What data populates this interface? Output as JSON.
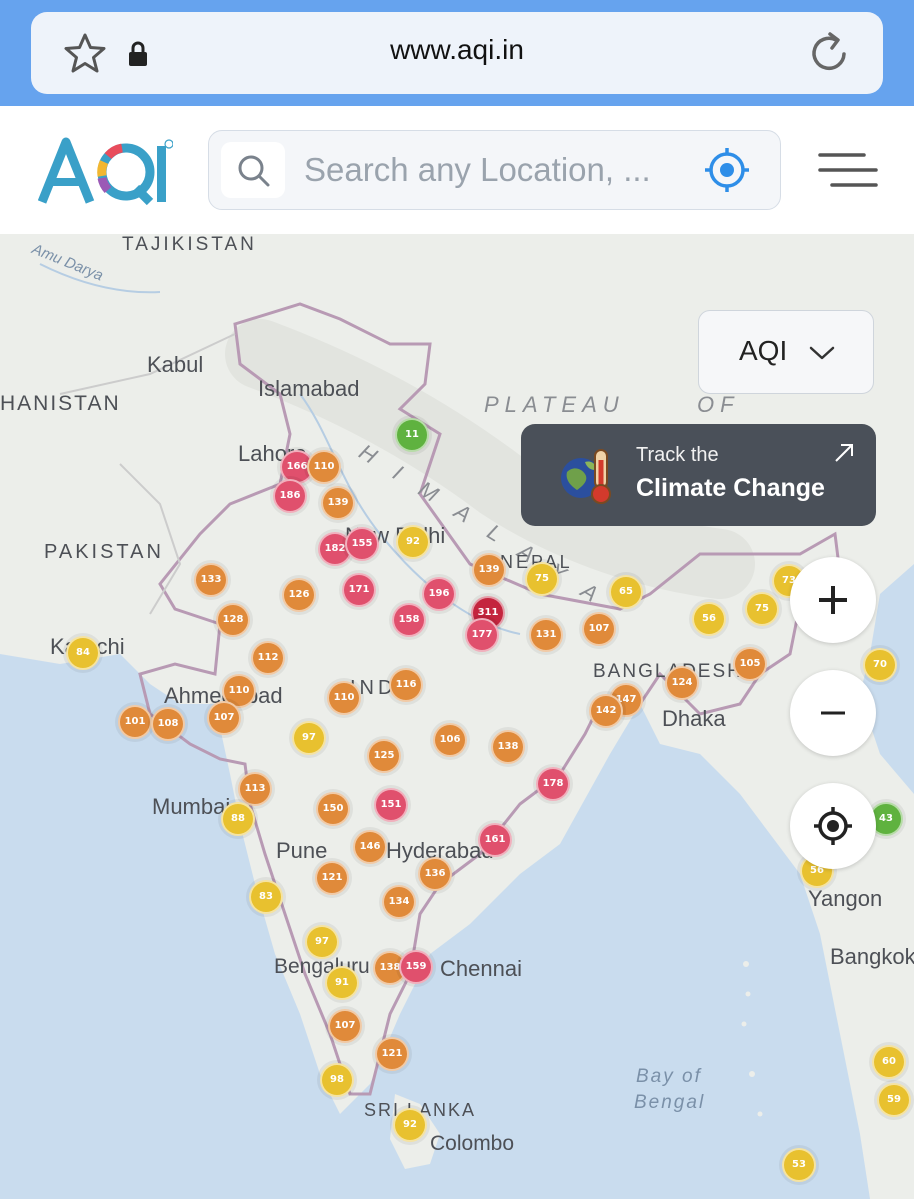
{
  "browser": {
    "url": "www.aqi.in"
  },
  "header": {
    "logo_text": "AQI",
    "search_placeholder": "Search any Location, ..."
  },
  "map": {
    "metric_dropdown": {
      "selected": "AQI"
    },
    "climate_card": {
      "line1": "Track the",
      "line2": "Climate Change"
    },
    "colors": {
      "good": "#5fb23f",
      "moderate": "#e8c12f",
      "poor": "#e08a3a",
      "unhealthy": "#e0506d",
      "severe": "#c4253e",
      "water": "#c9dcee",
      "land": "#eceeea",
      "border": "#b89ab4"
    },
    "labels": [
      {
        "text": "TAJIKISTAN"
      },
      {
        "text": "Amu Darya"
      },
      {
        "text": "Kabul"
      },
      {
        "text": "HANISTAN"
      },
      {
        "text": "Islamabad"
      },
      {
        "text": "PLATEAU"
      },
      {
        "text": "OF"
      },
      {
        "text": "Lahore"
      },
      {
        "text": "PAKISTAN"
      },
      {
        "text": "New Delhi"
      },
      {
        "text": "HIMALAYA"
      },
      {
        "text": "Karachi"
      },
      {
        "text": "Ahmedabad"
      },
      {
        "text": "INDIA"
      },
      {
        "text": "NEPAL"
      },
      {
        "text": "BANGLADESH"
      },
      {
        "text": "Dhaka"
      },
      {
        "text": "Mumbai"
      },
      {
        "text": "Pune"
      },
      {
        "text": "Hyderabad"
      },
      {
        "text": "Yangon"
      },
      {
        "text": "Bengaluru"
      },
      {
        "text": "Chennai"
      },
      {
        "text": "Bangkok"
      },
      {
        "text": "Bay of"
      },
      {
        "text": "Bengal"
      },
      {
        "text": "SRI LANKA"
      },
      {
        "text": "Colombo"
      }
    ],
    "markers": [
      {
        "value": "11",
        "level": "good"
      },
      {
        "value": "166",
        "level": "unhealthy"
      },
      {
        "value": "110",
        "level": "poor"
      },
      {
        "value": "186",
        "level": "unhealthy"
      },
      {
        "value": "139",
        "level": "poor"
      },
      {
        "value": "182",
        "level": "unhealthy"
      },
      {
        "value": "155",
        "level": "unhealthy"
      },
      {
        "value": "92",
        "level": "moderate"
      },
      {
        "value": "133",
        "level": "poor"
      },
      {
        "value": "126",
        "level": "poor"
      },
      {
        "value": "171",
        "level": "unhealthy"
      },
      {
        "value": "196",
        "level": "unhealthy"
      },
      {
        "value": "139",
        "level": "poor"
      },
      {
        "value": "75",
        "level": "moderate"
      },
      {
        "value": "65",
        "level": "moderate"
      },
      {
        "value": "128",
        "level": "poor"
      },
      {
        "value": "158",
        "level": "unhealthy"
      },
      {
        "value": "311",
        "level": "severe"
      },
      {
        "value": "177",
        "level": "unhealthy"
      },
      {
        "value": "131",
        "level": "poor"
      },
      {
        "value": "107",
        "level": "poor"
      },
      {
        "value": "56",
        "level": "moderate"
      },
      {
        "value": "75",
        "level": "moderate"
      },
      {
        "value": "73",
        "level": "moderate"
      },
      {
        "value": "84",
        "level": "moderate"
      },
      {
        "value": "112",
        "level": "poor"
      },
      {
        "value": "105",
        "level": "poor"
      },
      {
        "value": "70",
        "level": "moderate"
      },
      {
        "value": "110",
        "level": "poor"
      },
      {
        "value": "110",
        "level": "poor"
      },
      {
        "value": "116",
        "level": "poor"
      },
      {
        "value": "124",
        "level": "poor"
      },
      {
        "value": "147",
        "level": "poor"
      },
      {
        "value": "142",
        "level": "poor"
      },
      {
        "value": "101",
        "level": "poor"
      },
      {
        "value": "108",
        "level": "poor"
      },
      {
        "value": "107",
        "level": "poor"
      },
      {
        "value": "97",
        "level": "moderate"
      },
      {
        "value": "106",
        "level": "poor"
      },
      {
        "value": "138",
        "level": "poor"
      },
      {
        "value": "125",
        "level": "poor"
      },
      {
        "value": "178",
        "level": "unhealthy"
      },
      {
        "value": "113",
        "level": "poor"
      },
      {
        "value": "150",
        "level": "poor"
      },
      {
        "value": "151",
        "level": "unhealthy"
      },
      {
        "value": "88",
        "level": "moderate"
      },
      {
        "value": "43",
        "level": "good"
      },
      {
        "value": "161",
        "level": "unhealthy"
      },
      {
        "value": "146",
        "level": "poor"
      },
      {
        "value": "136",
        "level": "poor"
      },
      {
        "value": "121",
        "level": "poor"
      },
      {
        "value": "83",
        "level": "moderate"
      },
      {
        "value": "134",
        "level": "poor"
      },
      {
        "value": "56",
        "level": "moderate"
      },
      {
        "value": "97",
        "level": "moderate"
      },
      {
        "value": "138",
        "level": "poor"
      },
      {
        "value": "159",
        "level": "unhealthy"
      },
      {
        "value": "91",
        "level": "moderate"
      },
      {
        "value": "107",
        "level": "poor"
      },
      {
        "value": "121",
        "level": "poor"
      },
      {
        "value": "98",
        "level": "moderate"
      },
      {
        "value": "60",
        "level": "moderate"
      },
      {
        "value": "59",
        "level": "moderate"
      },
      {
        "value": "92",
        "level": "moderate"
      },
      {
        "value": "53",
        "level": "moderate"
      }
    ]
  }
}
